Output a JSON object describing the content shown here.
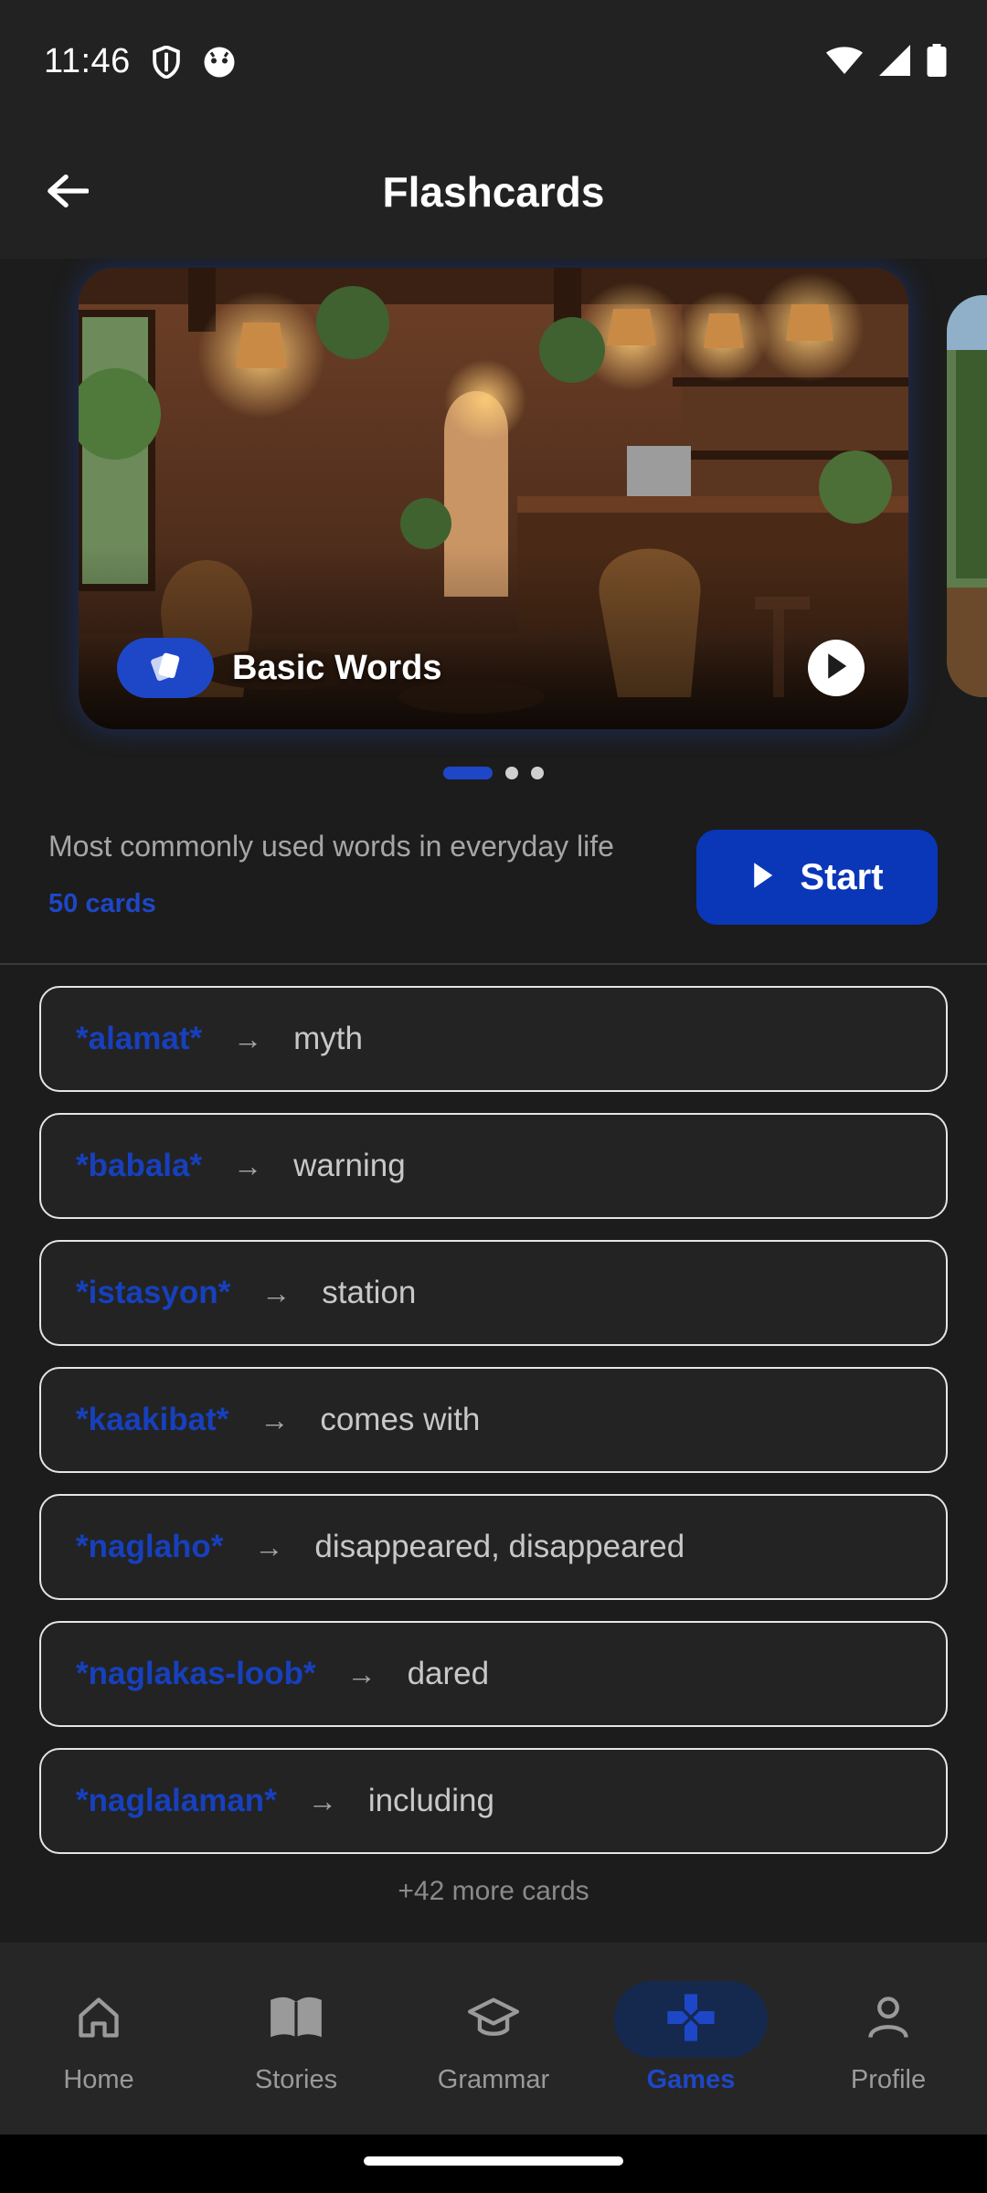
{
  "status_bar": {
    "time": "11:46",
    "icons": [
      "shield-icon",
      "cat-face-icon",
      "wifi-icon",
      "cellular-signal-icon",
      "battery-icon"
    ]
  },
  "app_bar": {
    "title": "Flashcards",
    "back_icon": "arrow-left-icon"
  },
  "carousel": {
    "active_deck": {
      "title": "Basic Words",
      "badge_icon": "flashcards-icon",
      "play_icon": "play-icon"
    },
    "page_count": 3,
    "active_index": 0
  },
  "deck_info": {
    "description": "Most commonly used words in everyday life",
    "card_count": "50 cards",
    "start_label": "Start"
  },
  "words": [
    {
      "term": "*alamat*",
      "arrow": "→",
      "meaning": "myth"
    },
    {
      "term": "*babala*",
      "arrow": "→",
      "meaning": "warning"
    },
    {
      "term": "*istasyon*",
      "arrow": "→",
      "meaning": "station"
    },
    {
      "term": "*kaakibat*",
      "arrow": "→",
      "meaning": "comes with"
    },
    {
      "term": "*naglaho*",
      "arrow": "→",
      "meaning": "disappeared, disappeared"
    },
    {
      "term": "*naglakas-loob*",
      "arrow": "→",
      "meaning": "dared"
    },
    {
      "term": "*naglalaman*",
      "arrow": "→",
      "meaning": "including"
    }
  ],
  "more_cards": "+42 more cards",
  "bottom_nav": [
    {
      "label": "Home",
      "icon": "home-icon",
      "active": false
    },
    {
      "label": "Stories",
      "icon": "book-icon",
      "active": false
    },
    {
      "label": "Grammar",
      "icon": "graduation-cap-icon",
      "active": false
    },
    {
      "label": "Games",
      "icon": "gamepad-icon",
      "active": true
    },
    {
      "label": "Profile",
      "icon": "person-icon",
      "active": false
    }
  ],
  "colors": {
    "accent": "#1E47C7",
    "start_button": "#0A37B8",
    "background": "#1C1C1C",
    "surface": "#232323"
  }
}
